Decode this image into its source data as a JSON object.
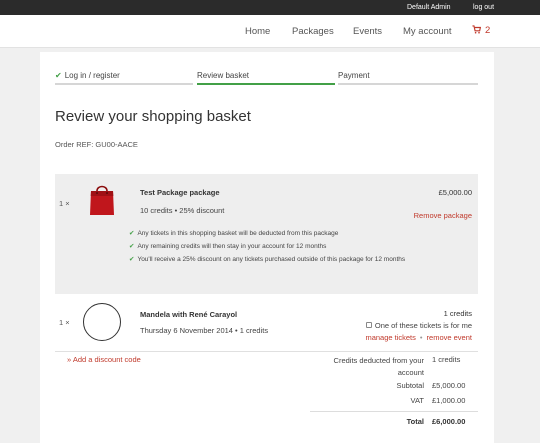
{
  "topbar": {
    "user": "Default Admin",
    "logout": "log out"
  },
  "nav": {
    "home": "Home",
    "packages": "Packages",
    "events": "Events",
    "account": "My account",
    "cart_count": "2"
  },
  "steps": [
    {
      "label": "Log in / register",
      "state": "done"
    },
    {
      "label": "Review basket",
      "state": "active"
    },
    {
      "label": "Payment",
      "state": "pending"
    }
  ],
  "page": {
    "title": "Review your shopping basket",
    "order_ref": "Order REF: GU00-AACE"
  },
  "package": {
    "qty": "1 ×",
    "name": "Test Package package",
    "meta": "10 credits • 25% discount",
    "price": "£5,000.00",
    "remove": "Remove package",
    "bullets": [
      "Any tickets in this shopping basket will be deducted from this package",
      "Any remaining credits will then stay in your account for 12 months",
      "You'll receive a 25% discount on any tickets purchased outside of this package for 12 months"
    ]
  },
  "event": {
    "qty": "1 ×",
    "name": "Mandela with René Carayol",
    "date": "Thursday 6 November 2014 • 1 credits",
    "credits": "1 credits",
    "checkbox_label": "One of these tickets is for me",
    "manage": "manage tickets",
    "remove": "remove event"
  },
  "footer": {
    "discount_link": "» Add a discount code",
    "credits_label": "Credits deducted from your account",
    "credits_value": "1 credits",
    "subtotal_label": "Subtotal",
    "subtotal_value": "£5,000.00",
    "vat_label": "VAT",
    "vat_value": "£1,000.00",
    "total_label": "Total",
    "total_value": "£6,000.00"
  },
  "colors": {
    "accent": "#c0392b",
    "success": "#43a047",
    "topbar": "#2b2b2b"
  }
}
